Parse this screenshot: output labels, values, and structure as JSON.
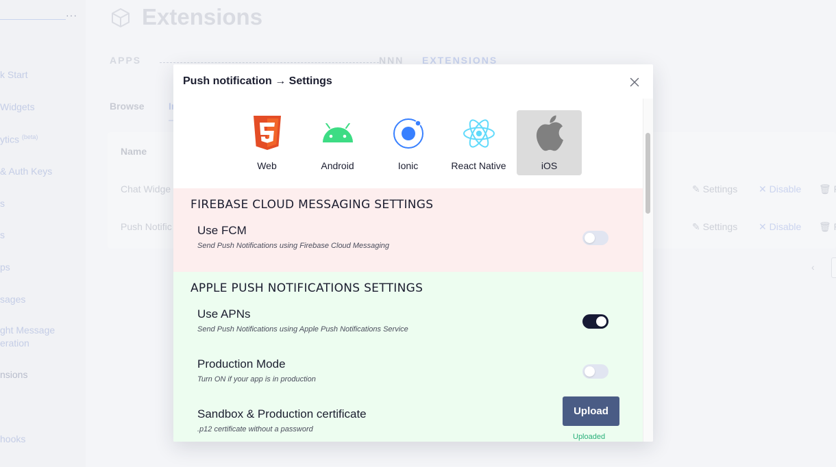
{
  "background": {
    "sidebar": {
      "items": [
        {
          "label": "k Start"
        },
        {
          "label": " Widgets"
        },
        {
          "label": "ytics",
          "badge": "(beta)"
        },
        {
          "label": "& Auth Keys"
        },
        {
          "label": "s"
        },
        {
          "label": "s"
        },
        {
          "label": "ps"
        },
        {
          "label": "sages"
        },
        {
          "label": "ght Message"
        },
        {
          "label": "eration"
        },
        {
          "label": "nsions"
        },
        {
          "label": "hooks"
        }
      ]
    },
    "page_title": "Extensions",
    "breadcrumb": {
      "apps": "APPS",
      "app_name": "NNN",
      "current": "EXTENSIONS"
    },
    "tabs": {
      "browse": "Browse",
      "installed": "In"
    },
    "table": {
      "header_name": "Name",
      "rows": [
        {
          "name": "Chat Widge",
          "settings": "Settings",
          "disable": "Disable",
          "remove": "R"
        },
        {
          "name": "Push Notific",
          "settings": "Settings",
          "disable": "Disable",
          "remove": "R"
        }
      ]
    }
  },
  "modal": {
    "title": "Push notification → Settings",
    "close_icon": "close-icon",
    "platforms": [
      {
        "label": "Web",
        "icon": "html5-icon",
        "color": "#e44d26"
      },
      {
        "label": "Android",
        "icon": "android-icon",
        "color": "#3ddc84"
      },
      {
        "label": "Ionic",
        "icon": "ionic-icon",
        "color": "#3880ff"
      },
      {
        "label": "React Native",
        "icon": "react-icon",
        "color": "#61dafb"
      },
      {
        "label": "iOS",
        "icon": "apple-icon",
        "color": "#808080",
        "selected": true
      }
    ],
    "fcm": {
      "section_title": "FIREBASE CLOUD MESSAGING SETTINGS",
      "use_fcm": {
        "title": "Use FCM",
        "description": "Send Push Notifications using Firebase Cloud Messaging",
        "enabled": false
      }
    },
    "apn": {
      "section_title": "APPLE PUSH NOTIFICATIONS SETTINGS",
      "use_apns": {
        "title": "Use APNs",
        "description": "Send Push Notifications using Apple Push Notifications Service",
        "enabled": true
      },
      "production_mode": {
        "title": "Production Mode",
        "description": "Turn ON if your app is in production",
        "enabled": false
      },
      "certificate": {
        "title": "Sandbox & Production certificate",
        "description": ".p12 certificate without a password",
        "upload_label": "Upload",
        "status": "Uploaded"
      }
    },
    "colors": {
      "fcm_bg": "#fdeeee",
      "apn_bg": "#edfdf0",
      "toggle_on": "#171a35",
      "upload_btn": "#4a5c85",
      "uploaded_text": "#2ab07a"
    }
  }
}
